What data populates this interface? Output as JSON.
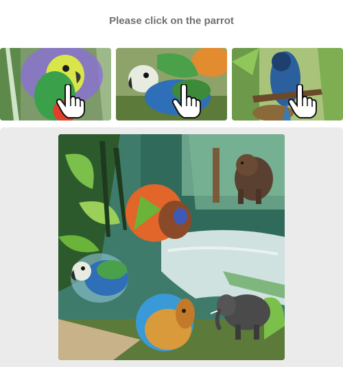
{
  "prompt": {
    "text": "Please click on the parrot"
  },
  "examples": [
    {
      "subject": "parrot",
      "cursor": "hand-pointer-icon"
    },
    {
      "subject": "parrot",
      "cursor": "hand-pointer-icon"
    },
    {
      "subject": "parrot",
      "cursor": "hand-pointer-icon"
    }
  ],
  "challenge": {
    "animals": [
      "squirrel",
      "bear",
      "parrot",
      "lion",
      "elephant"
    ],
    "background": "jungle river"
  },
  "colors": {
    "panel": "#ebebeb",
    "prompt_text": "#6f6f6f"
  }
}
